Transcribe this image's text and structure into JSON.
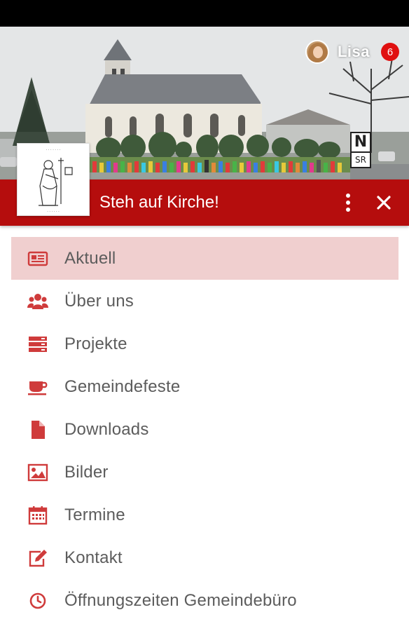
{
  "header": {
    "user_name": "Lisa",
    "notification_count": "6",
    "title": "Steh auf Kirche!",
    "brand_color": "#b50d0d",
    "nsr_logo": {
      "line1": "N",
      "line2": "SR"
    }
  },
  "menu": {
    "active_index": 0,
    "items": [
      {
        "label": "Aktuell",
        "icon": "newspaper-icon"
      },
      {
        "label": "Über uns",
        "icon": "users-icon"
      },
      {
        "label": "Projekte",
        "icon": "server-stack-icon"
      },
      {
        "label": "Gemeindefeste",
        "icon": "coffee-cup-icon"
      },
      {
        "label": "Downloads",
        "icon": "file-icon"
      },
      {
        "label": "Bilder",
        "icon": "image-icon"
      },
      {
        "label": "Termine",
        "icon": "calendar-icon"
      },
      {
        "label": "Kontakt",
        "icon": "edit-icon"
      },
      {
        "label": "Öffnungszeiten Gemeindebüro",
        "icon": "clock-icon"
      }
    ]
  }
}
